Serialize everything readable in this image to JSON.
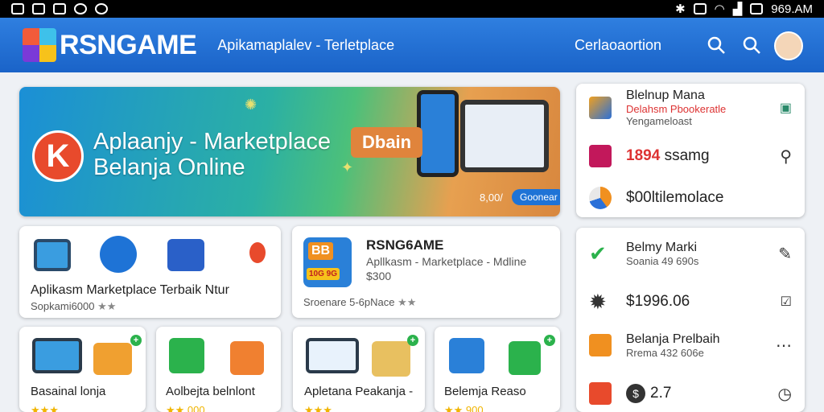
{
  "statusbar": {
    "time": "969.AM"
  },
  "appbar": {
    "brand": "RSNGAME",
    "subtitle": "Apikamaplalev - Terletplace",
    "center_link": "Cerlaoaortion"
  },
  "banner": {
    "line1": "Aplaanjy - Marketplace",
    "line2": "Belanja Online",
    "tag": "Dbain",
    "price": "8,00/",
    "pill": "Goonear"
  },
  "side_top": [
    {
      "title": "Blelnup Mana",
      "sub": "Delahsm Pbookeratle",
      "sub2": "Yengameloast"
    },
    {
      "big": "1894",
      "big_rest": "ssamg"
    },
    {
      "big": "$00ltilemolace"
    }
  ],
  "side_bottom": [
    {
      "title": "Belmy Marki",
      "sub": "Soania 49 690s"
    },
    {
      "big": "$1996.06"
    },
    {
      "title": "Belanja Prelbaih",
      "sub": "Rrema 432 606e"
    },
    {
      "big": "2.7"
    }
  ],
  "card_a": {
    "title": "Aplikasm Marketplace Terbaik Ntur",
    "sub": "Sopkami6000",
    "stars": "★★"
  },
  "card_b": {
    "title": "RSNG6AME",
    "sub1": "Apllkasm - Marketplace - Mdline",
    "sub2": "$300",
    "sub3": "Sroenare 5-6pNace",
    "stars": "★★",
    "icon_text": "BB",
    "icon_badge": "10G 9G"
  },
  "row_cards": [
    {
      "title": "Basainal lonja",
      "stars": "★★★"
    },
    {
      "title": "Aolbejta belnlont",
      "stars": "★★ 000"
    },
    {
      "title": "Apletana Peakanja -",
      "stars": "★★★"
    },
    {
      "title": "Belemja Reaso",
      "stars": "★★ 900"
    }
  ],
  "colors": {
    "appbar": "#1a63c8",
    "accent_red": "#e84a2c",
    "star": "#f0b400"
  }
}
